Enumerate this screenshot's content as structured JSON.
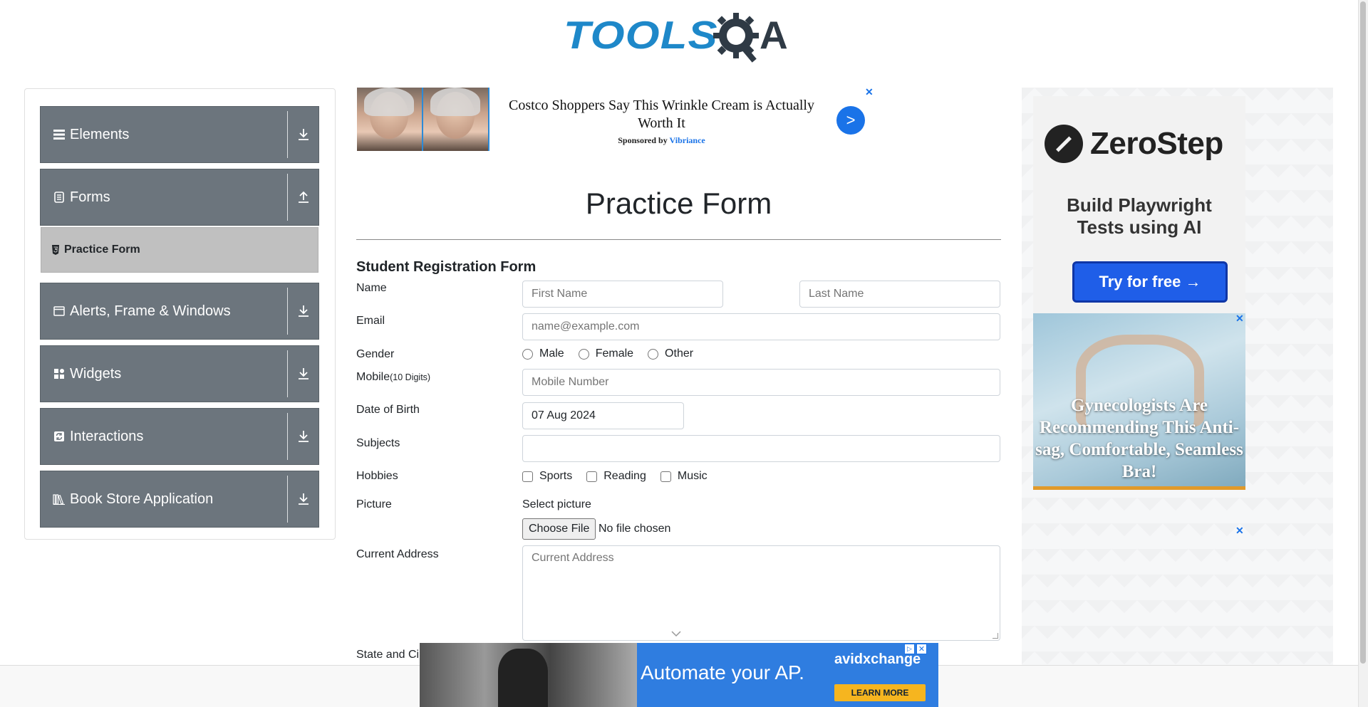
{
  "header": {
    "logo_text": "TOOLS",
    "logo_suffix": "A"
  },
  "sidebar": {
    "groups": [
      {
        "label": "Elements",
        "icon": "menu-icon",
        "arrow": "download-icon"
      },
      {
        "label": "Forms",
        "icon": "document-icon",
        "arrow": "upload-icon"
      },
      {
        "label": "Alerts, Frame & Windows",
        "icon": "window-icon",
        "arrow": "download-icon"
      },
      {
        "label": "Widgets",
        "icon": "grid-icon",
        "arrow": "download-icon"
      },
      {
        "label": "Interactions",
        "icon": "refresh-icon",
        "arrow": "download-icon"
      },
      {
        "label": "Book Store Application",
        "icon": "books-icon",
        "arrow": "download-icon"
      }
    ],
    "active_item": {
      "label": "Practice Form",
      "icon": "html5-icon"
    }
  },
  "ad_top": {
    "headline": "Costco Shoppers Say This Wrinkle Cream is Actually Worth It",
    "sponsored_by": "Sponsored by",
    "brand": "Vibriance",
    "go_label": ">",
    "close_label": "✕"
  },
  "main": {
    "title": "Practice Form",
    "form_title": "Student Registration Form",
    "name": {
      "label": "Name",
      "first_placeholder": "First Name",
      "last_placeholder": "Last Name"
    },
    "email": {
      "label": "Email",
      "placeholder": "name@example.com"
    },
    "gender": {
      "label": "Gender",
      "options": [
        "Male",
        "Female",
        "Other"
      ]
    },
    "mobile": {
      "label": "Mobile",
      "hint": "(10 Digits)",
      "placeholder": "Mobile Number"
    },
    "dob": {
      "label": "Date of Birth",
      "value": "07 Aug 2024"
    },
    "subjects": {
      "label": "Subjects",
      "value": ""
    },
    "hobbies": {
      "label": "Hobbies",
      "options": [
        "Sports",
        "Reading",
        "Music"
      ]
    },
    "picture": {
      "label": "Picture",
      "select_label": "Select picture",
      "button_label": "Choose File",
      "status": "No file chosen"
    },
    "address": {
      "label": "Current Address",
      "placeholder": "Current Address"
    },
    "state_city": {
      "label": "State and Ci"
    }
  },
  "right_ad": {
    "zerostep": {
      "brand": "ZeroStep",
      "tagline_line1": "Build Playwright",
      "tagline_line2": "Tests using AI",
      "button_label": "Try for free →"
    },
    "bra": {
      "text": "Gynecologists Are Recommending This Anti-sag, Comfortable, Seamless Bra!",
      "close_label": "✕"
    },
    "close_label_2": "✕"
  },
  "bottom_ad": {
    "headline": "Automate your AP.",
    "brand": "avidxchange",
    "cta": "LEARN MORE",
    "close_label": "✕",
    "info_label": "▷"
  },
  "colors": {
    "sidebar_group": "#6c757d",
    "active_item": "#c0c0c0",
    "accent": "#1a73e8"
  }
}
